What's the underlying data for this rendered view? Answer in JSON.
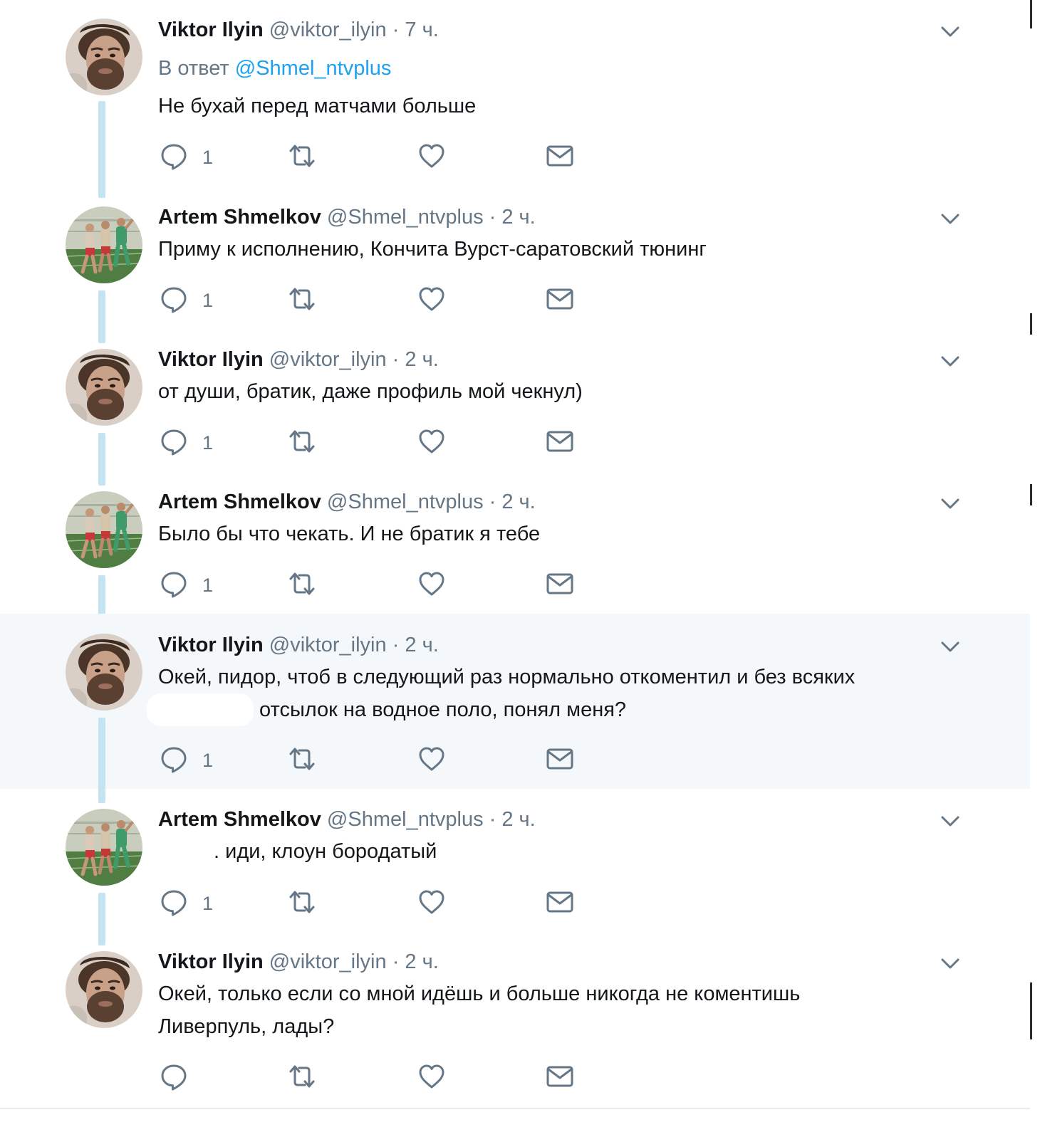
{
  "tweets": [
    {
      "author": "viktor",
      "name": "Viktor Ilyin",
      "handle": "@viktor_ilyin",
      "sep": "·",
      "time": "7 ч.",
      "reply_prefix": "В ответ",
      "reply_mention": "@Shmel_ntvplus",
      "text": "Не бухай перед матчами больше",
      "reply_count": "1",
      "highlighted": false
    },
    {
      "author": "artem",
      "name": "Artem Shmelkov",
      "handle": "@Shmel_ntvplus",
      "sep": "·",
      "time": "2 ч.",
      "text": "Приму к исполнению, Кончита Вурст-саратовский тюнинг",
      "reply_count": "1",
      "highlighted": false
    },
    {
      "author": "viktor",
      "name": "Viktor Ilyin",
      "handle": "@viktor_ilyin",
      "sep": "·",
      "time": "2 ч.",
      "text": "от души, братик, даже профиль мой чекнул)",
      "reply_count": "1",
      "highlighted": false
    },
    {
      "author": "artem",
      "name": "Artem Shmelkov",
      "handle": "@Shmel_ntvplus",
      "sep": "·",
      "time": "2 ч.",
      "text": "Было бы что чекать. И не братик я тебе",
      "reply_count": "1",
      "highlighted": false
    },
    {
      "author": "viktor",
      "name": "Viktor Ilyin",
      "handle": "@viktor_ilyin",
      "sep": "·",
      "time": "2 ч.",
      "text_line1": "Окей, пидор, чтоб в следующий раз нормально откоментил и без всяких",
      "text_line2": "отсылок на водное поло, понял меня?",
      "reply_count": "1",
      "highlighted": true
    },
    {
      "author": "artem",
      "name": "Artem Shmelkov",
      "handle": "@Shmel_ntvplus",
      "sep": "·",
      "time": "2 ч.",
      "text": ". иди, клоун бородатый",
      "reply_count": "1",
      "highlighted": false
    },
    {
      "author": "viktor",
      "name": "Viktor Ilyin",
      "handle": "@viktor_ilyin",
      "sep": "·",
      "time": "2 ч.",
      "text_line1": "Окей, только если со мной идёшь и больше никогда не коментишь",
      "text_line2": "Ливерпуль, лады?",
      "reply_count": "",
      "highlighted": false
    }
  ],
  "icons": {
    "reply": "reply-icon",
    "retweet": "retweet-icon",
    "like": "heart-icon",
    "dm": "envelope-icon",
    "menu": "chevron-down-icon"
  },
  "colors": {
    "link": "#1da1f2",
    "secondary_text": "#657786",
    "thread_line": "#c4e4f3",
    "highlight_bg": "#f5f8fa"
  }
}
